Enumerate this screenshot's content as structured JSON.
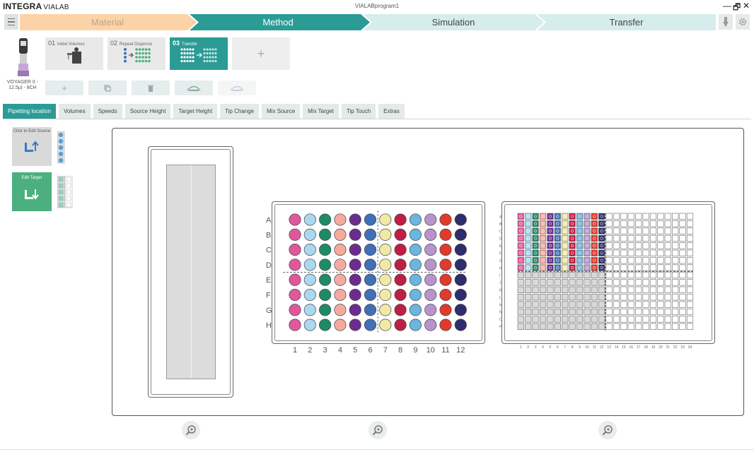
{
  "app": {
    "logo_main": "INTEGRA",
    "logo_sub": "VIALAB",
    "window_title": "VIALABprogram1",
    "controls": {
      "minimize": "—",
      "restore": "🗗",
      "close": "✕"
    }
  },
  "steps": [
    {
      "label": "Material",
      "state": "done",
      "color": "#fcd3a7",
      "text_color": "#b9a48d"
    },
    {
      "label": "Method",
      "state": "active",
      "color": "#2b9b96",
      "text_color": "#ffffff"
    },
    {
      "label": "Simulation",
      "state": "pending",
      "color": "#d7ecec",
      "text_color": "#444444"
    },
    {
      "label": "Transfer",
      "state": "pending",
      "color": "#d7ecec",
      "text_color": "#444444"
    }
  ],
  "device": {
    "name": "VOYAGER II - 12.5µl - 8CH"
  },
  "program_steps": [
    {
      "num": "01",
      "label": "Initial Volumes",
      "active": false
    },
    {
      "num": "02",
      "label": "Repeat Dispense",
      "active": false
    },
    {
      "num": "03",
      "label": "Transfer",
      "active": true
    }
  ],
  "add_step_label": "+",
  "toolbar": {
    "add": "+",
    "copy": "⧉",
    "delete": "🗑"
  },
  "tabs": [
    "Pipetting location",
    "Volumes",
    "Speeds",
    "Source Height",
    "Target Height",
    "Tip Change",
    "Mix Source",
    "Mix Target",
    "Tip Touch",
    "Extras"
  ],
  "active_tab": "Pipetting location",
  "source": {
    "button_label": "Click to Edit Source"
  },
  "target": {
    "button_label": "Edit Target"
  },
  "plate96": {
    "row_labels": [
      "A",
      "B",
      "C",
      "D",
      "E",
      "F",
      "G",
      "H"
    ],
    "col_labels": [
      "1",
      "2",
      "3",
      "4",
      "5",
      "6",
      "7",
      "8",
      "9",
      "10",
      "11",
      "12"
    ],
    "column_colors": [
      "#e0589c",
      "#a9d8f0",
      "#1e8a6a",
      "#f5aa9e",
      "#6a2d8f",
      "#3f70b8",
      "#f0eaa6",
      "#bf1f44",
      "#6bb6de",
      "#b894cc",
      "#e03a2d",
      "#2e2d6e"
    ]
  },
  "plate384": {
    "row_labels": [
      "A",
      "B",
      "C",
      "D",
      "E",
      "F",
      "G",
      "H",
      "I",
      "J",
      "K",
      "L",
      "M",
      "N",
      "O",
      "P"
    ],
    "col_labels": [
      "1",
      "2",
      "3",
      "4",
      "5",
      "6",
      "7",
      "8",
      "9",
      "10",
      "11",
      "12",
      "13",
      "14",
      "15",
      "16",
      "17",
      "18",
      "19",
      "20",
      "21",
      "22",
      "23",
      "24"
    ],
    "filled_rows": 8,
    "filled_cols": 12,
    "grey_rows_from": 8,
    "grey_cols": 12
  }
}
